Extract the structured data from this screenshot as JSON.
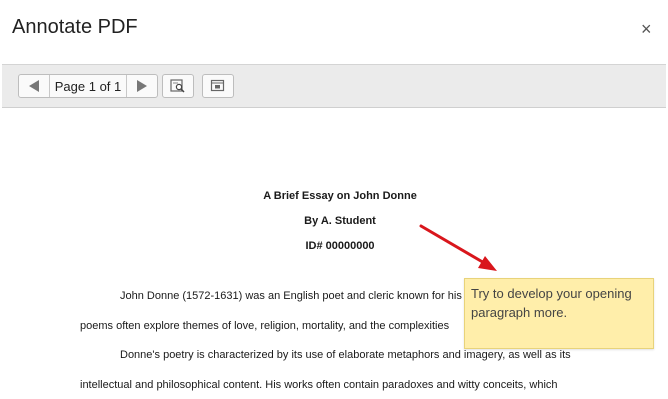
{
  "dialog": {
    "title": "Annotate PDF",
    "close_label": "×"
  },
  "toolbar": {
    "page_label": "Page 1 of 1",
    "buttons": [
      "previous-page",
      "next-page",
      "find-in-page",
      "expand-view"
    ]
  },
  "document": {
    "title": "A Brief Essay on John Donne",
    "author": "By A. Student",
    "id_line": "ID# 00000000",
    "lines": [
      "John Donne (1572-1631) was an English poet and cleric known for his",
      "poems often explore themes of love, religion, mortality, and the complexities",
      "Donne's poetry is characterized by its use of elaborate metaphors and imagery, as well as its",
      "intellectual and philosophical content. His works often contain paradoxes and witty conceits, which"
    ]
  },
  "annotation": {
    "text": "Try to develop your opening paragraph more.",
    "note_color": "#ffeeaa",
    "arrow_color": "#d9161c"
  }
}
